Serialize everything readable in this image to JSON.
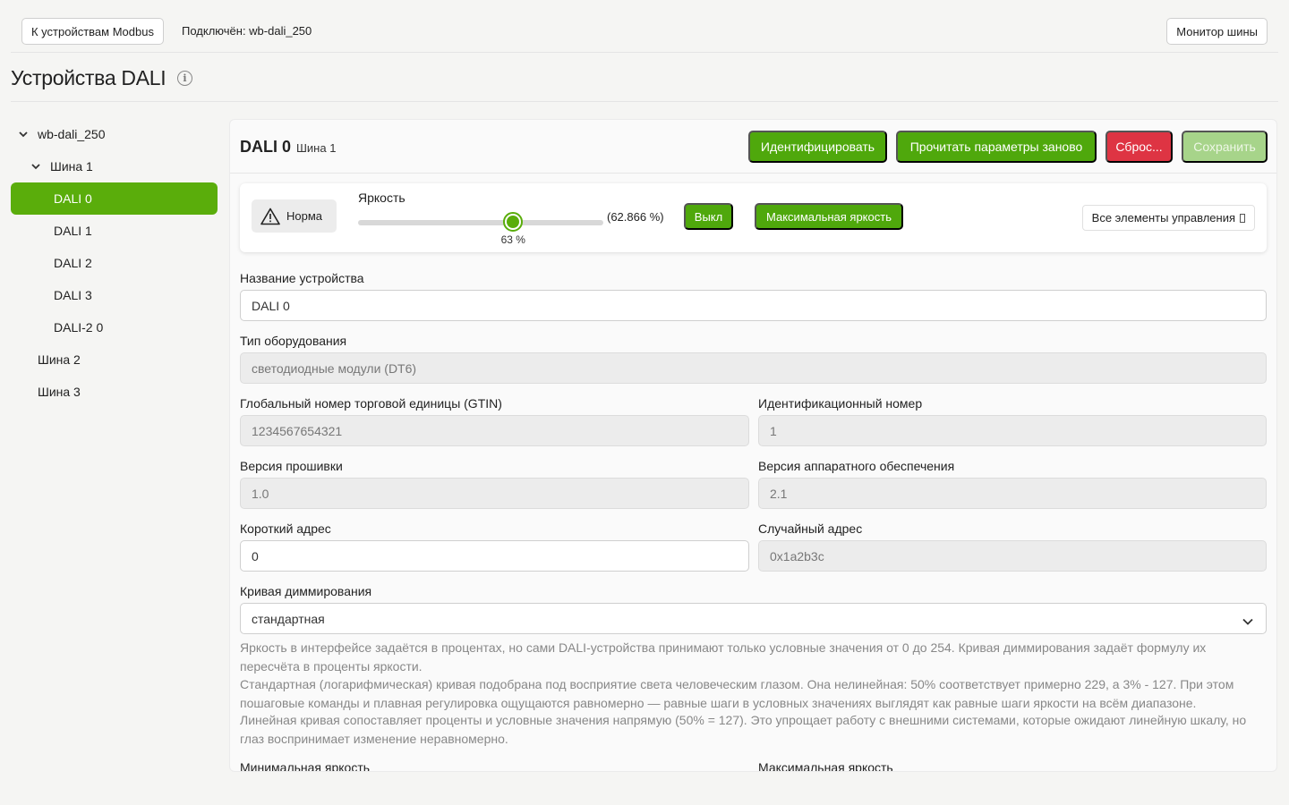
{
  "topbar": {
    "back_label": "К устройствам Modbus",
    "connected": "Подключён: wb-dali_250",
    "monitor_label": "Монитор шины"
  },
  "page": {
    "title": "Устройства DALI"
  },
  "sidebar": {
    "gateway": "wb-dali_250",
    "bus1": "Шина 1",
    "devices": [
      "DALI 0",
      "DALI 1",
      "DALI 2",
      "DALI 3",
      "DALI-2 0"
    ],
    "bus2": "Шина 2",
    "bus3": "Шина 3"
  },
  "device": {
    "title": "DALI 0",
    "bus": "Шина 1",
    "actions": {
      "identify": "Идентифицировать",
      "reread": "Прочитать параметры заново",
      "reset": "Сброс...",
      "save": "Сохранить"
    }
  },
  "controls": {
    "status": "Норма",
    "brightness_label": "Яркость",
    "brightness_value": 63,
    "slider_value_text": "63 %",
    "percent_text": "(62.866 %)",
    "off_label": "Выкл",
    "max_label": "Максимальная яркость",
    "all_controls_label": "Все элементы управления"
  },
  "form": {
    "name_label": "Название устройства",
    "name_value": "DALI 0",
    "type_label": "Тип оборудования",
    "type_value": "светодиодные модули (DT6)",
    "gtin_label": "Глобальный номер торговой единицы (GTIN)",
    "gtin_value": "1234567654321",
    "id_label": "Идентификационный номер",
    "id_value": "1",
    "fw_label": "Версия прошивки",
    "fw_value": "1.0",
    "hw_label": "Версия аппаратного обеспечения",
    "hw_value": "2.1",
    "short_label": "Короткий адрес",
    "short_value": "0",
    "random_label": "Случайный адрес",
    "random_value": "0x1a2b3c",
    "curve_label": "Кривая диммирования",
    "curve_value": "стандартная",
    "help1": "Яркость в интерфейсе задаётся в процентах, но сами DALI-устройства принимают только условные значения от 0 до 254. Кривая диммирования задаёт формулу их пересчёта в проценты яркости.",
    "help2": "Стандартная (логарифмическая) кривая подобрана под восприятие света человеческим глазом. Она нелинейная: 50% соответствует примерно 229, а 3% - 127. При этом пошаговые команды и плавная регулировка ощущаются равномерно — равные шаги в условных значениях выглядят как равные шаги яркости на всём диапазоне.",
    "help3": "Линейная кривая сопоставляет проценты и условные значения напрямую (50% = 127). Это упрощает работу с внешними системами, которые ожидают линейную шкалу, но глаз воспринимает изменение неравномерно.",
    "min_label": "Минимальная яркость",
    "max_label": "Максимальная яркость"
  },
  "colors": {
    "accent": "#5aad0b",
    "danger": "#de3443"
  }
}
